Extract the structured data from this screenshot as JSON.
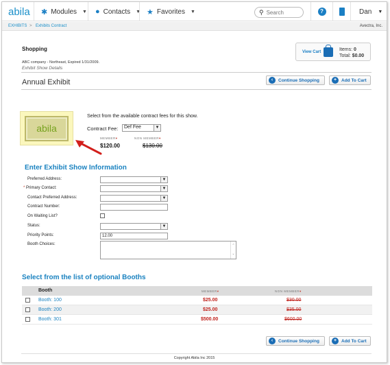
{
  "nav": {
    "logo": "abila",
    "modules": "Modules",
    "contacts": "Contacts",
    "favorites": "Favorites",
    "search_placeholder": "Search",
    "help": "?",
    "user": "Dan"
  },
  "breadcrumb": {
    "items": [
      "EXHIBITS",
      "Exhibits Contract"
    ],
    "org": "Avectra, Inc."
  },
  "header": {
    "section": "Shopping",
    "company_line": "ABC company  -  Northeast, Expired 1/31/2009.",
    "subtitle": "Exhibit Show Details",
    "title": "Annual Exhibit"
  },
  "cart": {
    "view_cart": "View Cart",
    "items_label": "Items:",
    "items_value": "0",
    "total_label": "Total:",
    "total_value": "$0.00"
  },
  "buttons": {
    "continue_shopping": "Continue Shopping",
    "add_to_cart": "Add To Cart"
  },
  "fees": {
    "intro": "Select from the available contract fees for this show.",
    "fee_label": "Contract Fee:",
    "fee_value": "Def Fee",
    "member_header": "MEMBER",
    "nonmember_header": "NON MEMBER",
    "member_price": "$120.00",
    "nonmember_price": "$130.00"
  },
  "form": {
    "heading": "Enter Exhibit Show Information",
    "preferred_address": "Preferred Address:",
    "primary_contact": "Primary Contact:",
    "contact_preferred_address": "Contact Preferred Address:",
    "contract_number": "Contract Number:",
    "on_waiting_list": "On Waiting List?",
    "status": "Status:",
    "priority_points": "Priority Points:",
    "priority_points_value": "12.00",
    "booth_choices": "Booth Choices:",
    "required_mark": "*"
  },
  "booths": {
    "heading": "Select from the list of optional Booths",
    "col_booth": "Booth",
    "col_member": "MEMBER",
    "col_nonmember": "NON MEMBER",
    "rows": [
      {
        "name": "Booth: 100",
        "member": "$25.00",
        "nonmember": "$30.00"
      },
      {
        "name": "Booth: 200",
        "member": "$25.00",
        "nonmember": "$35.00"
      },
      {
        "name": "Booth: 301",
        "member": "$500.00",
        "nonmember": "$600.00"
      }
    ]
  },
  "footer": {
    "copyright": "Copyright Abila Inc 2015"
  },
  "colors": {
    "accent": "#1a82c0",
    "price_red": "#c0211b",
    "logo_green": "#77a21f"
  }
}
